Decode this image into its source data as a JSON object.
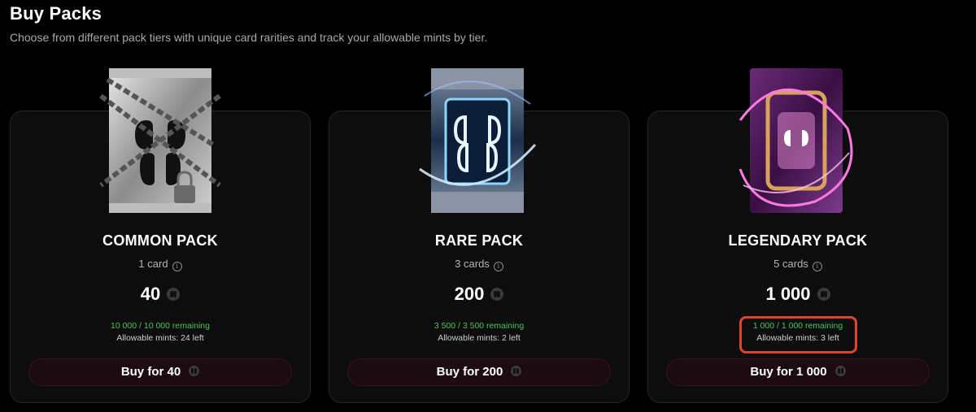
{
  "header": {
    "title": "Buy Packs",
    "subtitle": "Choose from different pack tiers with unique card rarities and track your allowable mints by tier."
  },
  "packs": [
    {
      "name": "COMMON PACK",
      "cards": "1 card",
      "price": "40",
      "remaining": "10 000 / 10 000 remaining",
      "allowable": "Allowable mints: 24 left",
      "buy_label": "Buy for 40",
      "icon": "chained-pack-icon"
    },
    {
      "name": "RARE PACK",
      "cards": "3 cards",
      "price": "200",
      "remaining": "3 500 / 3 500 remaining",
      "allowable": "Allowable mints: 2 left",
      "buy_label": "Buy for 200",
      "icon": "neon-blue-pack-icon"
    },
    {
      "name": "LEGENDARY PACK",
      "cards": "5 cards",
      "price": "1 000",
      "remaining": "1 000 / 1 000 remaining",
      "allowable": "Allowable mints: 3 left",
      "buy_label": "Buy for 1 000",
      "icon": "neon-pink-pack-icon"
    }
  ],
  "colors": {
    "accent_green": "#4cc25d",
    "highlight_red": "#e0442c",
    "button_bg": "#1c0b11"
  }
}
